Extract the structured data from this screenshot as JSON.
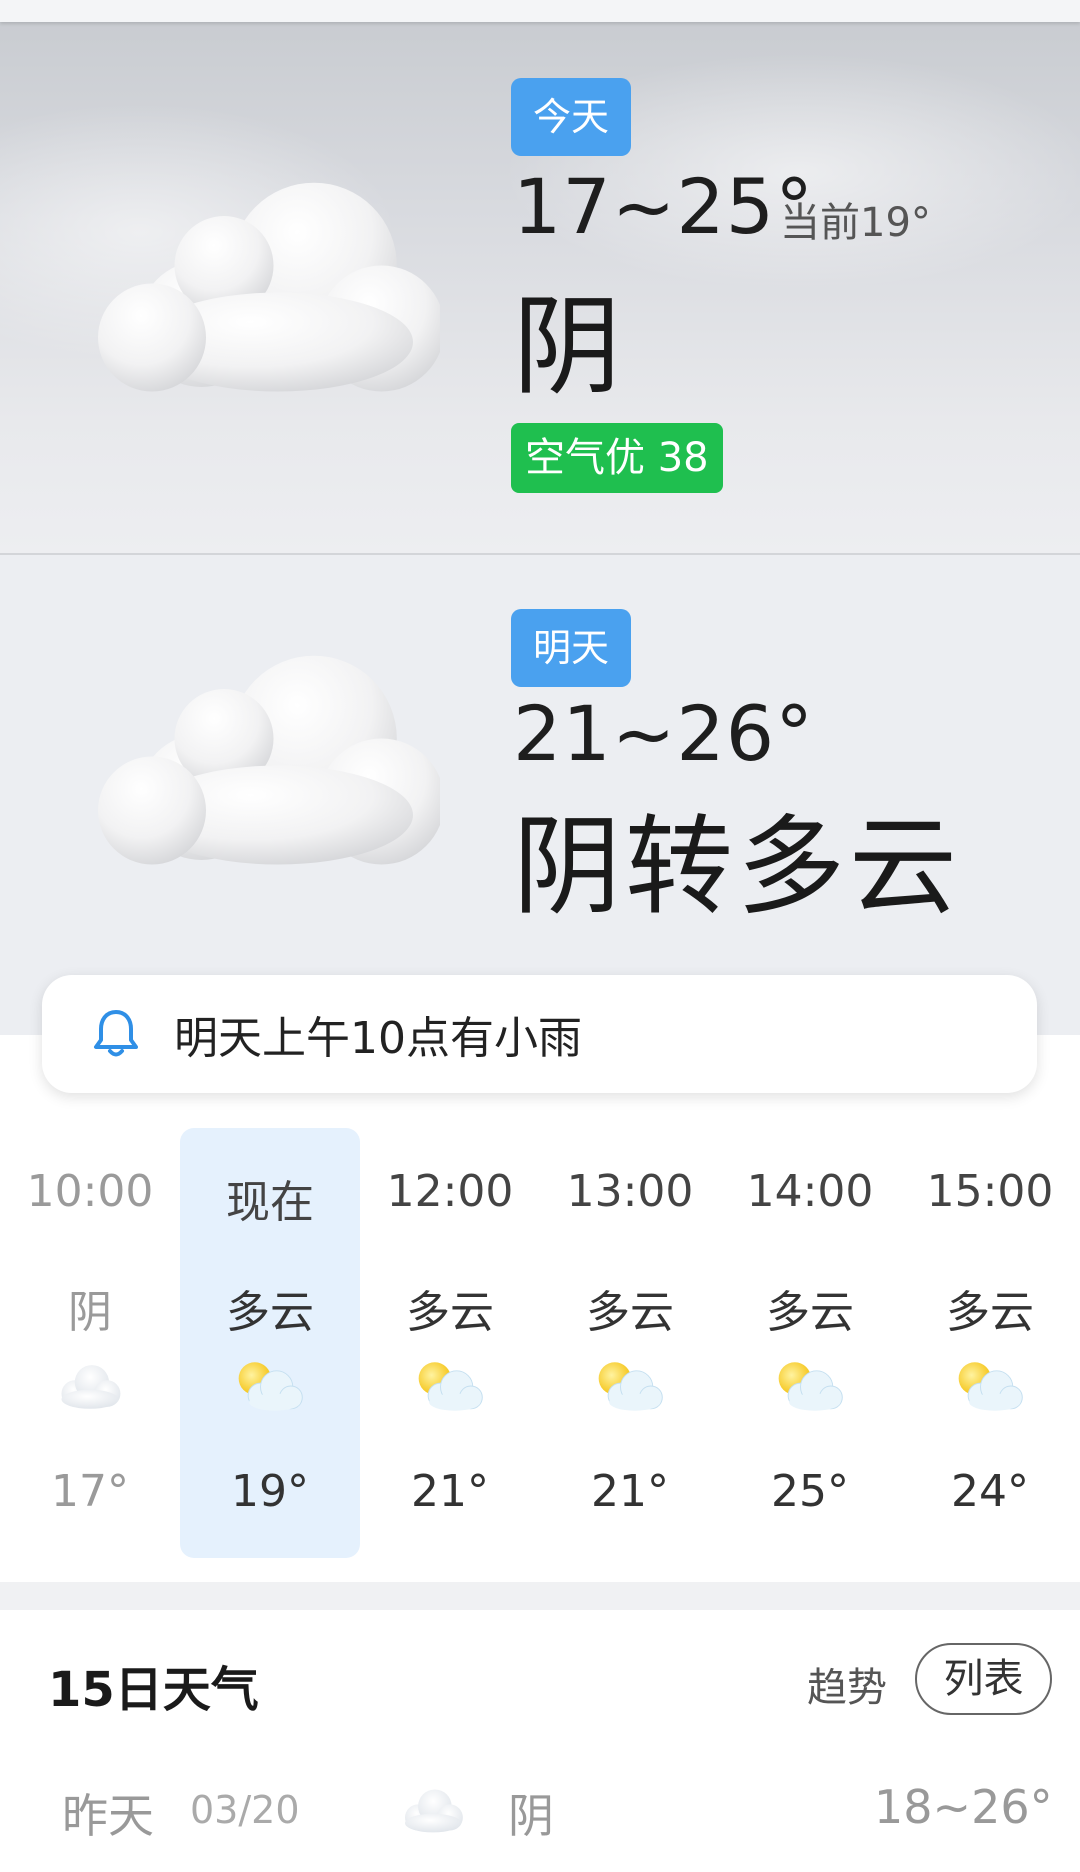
{
  "today": {
    "tag": "今天",
    "temp_range": "17~25°",
    "current": "当前19°",
    "condition": "阴",
    "aqi": "空气优 38",
    "icon": "overcast-cloud-icon"
  },
  "tomorrow": {
    "tag": "明天",
    "temp_range": "21~26°",
    "condition": "阴转多云",
    "icon": "overcast-cloud-icon"
  },
  "alert": {
    "icon": "bell-icon",
    "text": "明天上午10点有小雨"
  },
  "hourly": [
    {
      "time": "10:00",
      "cond": "阴",
      "temp": "17°",
      "icon": "cloud-icon",
      "state": "past"
    },
    {
      "time": "现在",
      "cond": "多云",
      "temp": "19°",
      "icon": "partly-cloudy-icon",
      "state": "now"
    },
    {
      "time": "12:00",
      "cond": "多云",
      "temp": "21°",
      "icon": "partly-cloudy-icon",
      "state": "future"
    },
    {
      "time": "13:00",
      "cond": "多云",
      "temp": "21°",
      "icon": "partly-cloudy-icon",
      "state": "future"
    },
    {
      "time": "14:00",
      "cond": "多云",
      "temp": "25°",
      "icon": "partly-cloudy-icon",
      "state": "future"
    },
    {
      "time": "15:00",
      "cond": "多云",
      "temp": "24°",
      "icon": "partly-cloudy-icon",
      "state": "future"
    }
  ],
  "forecast": {
    "title": "15日天气",
    "trend_label": "趋势",
    "list_label": "列表",
    "days": [
      {
        "name": "昨天",
        "date": "03/20",
        "cond": "阴",
        "temp": "18~26°",
        "icon": "cloud-icon"
      }
    ]
  },
  "colors": {
    "tag_blue": "#4aa1ef",
    "aqi_green": "#1fbf4f",
    "alert_blue": "#2f8fe6",
    "now_highlight": "#e5f1fd"
  }
}
